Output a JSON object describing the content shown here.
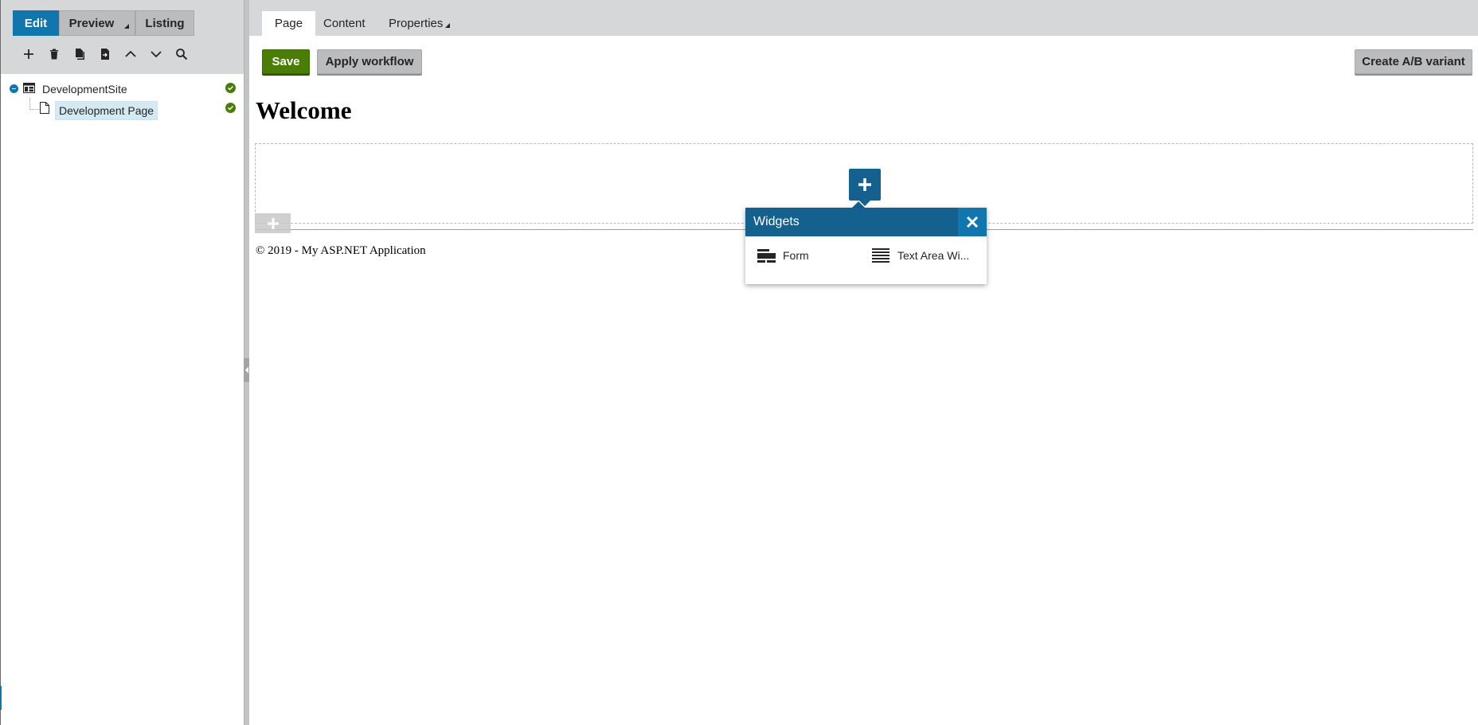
{
  "modes": {
    "edit": "Edit",
    "preview": "Preview",
    "listing": "Listing"
  },
  "tree": {
    "site": "DevelopmentSite",
    "page": "Development Page"
  },
  "tabs": {
    "page": "Page",
    "content": "Content",
    "properties": "Properties"
  },
  "actions": {
    "save": "Save",
    "apply_workflow": "Apply workflow",
    "create_ab": "Create A/B variant"
  },
  "page": {
    "heading": "Welcome",
    "footer": "© 2019 - My ASP.NET Application"
  },
  "widgets_popup": {
    "title": "Widgets",
    "items": [
      {
        "label": "Form",
        "icon": "form-icon"
      },
      {
        "label": "Text Area Wi...",
        "icon": "text-area-icon"
      }
    ]
  },
  "colors": {
    "primary_blue": "#1175ae",
    "dark_blue": "#14608f",
    "save_green": "#497d04",
    "panel_gray": "#d6d7d8",
    "button_gray": "#bbbcbd"
  }
}
